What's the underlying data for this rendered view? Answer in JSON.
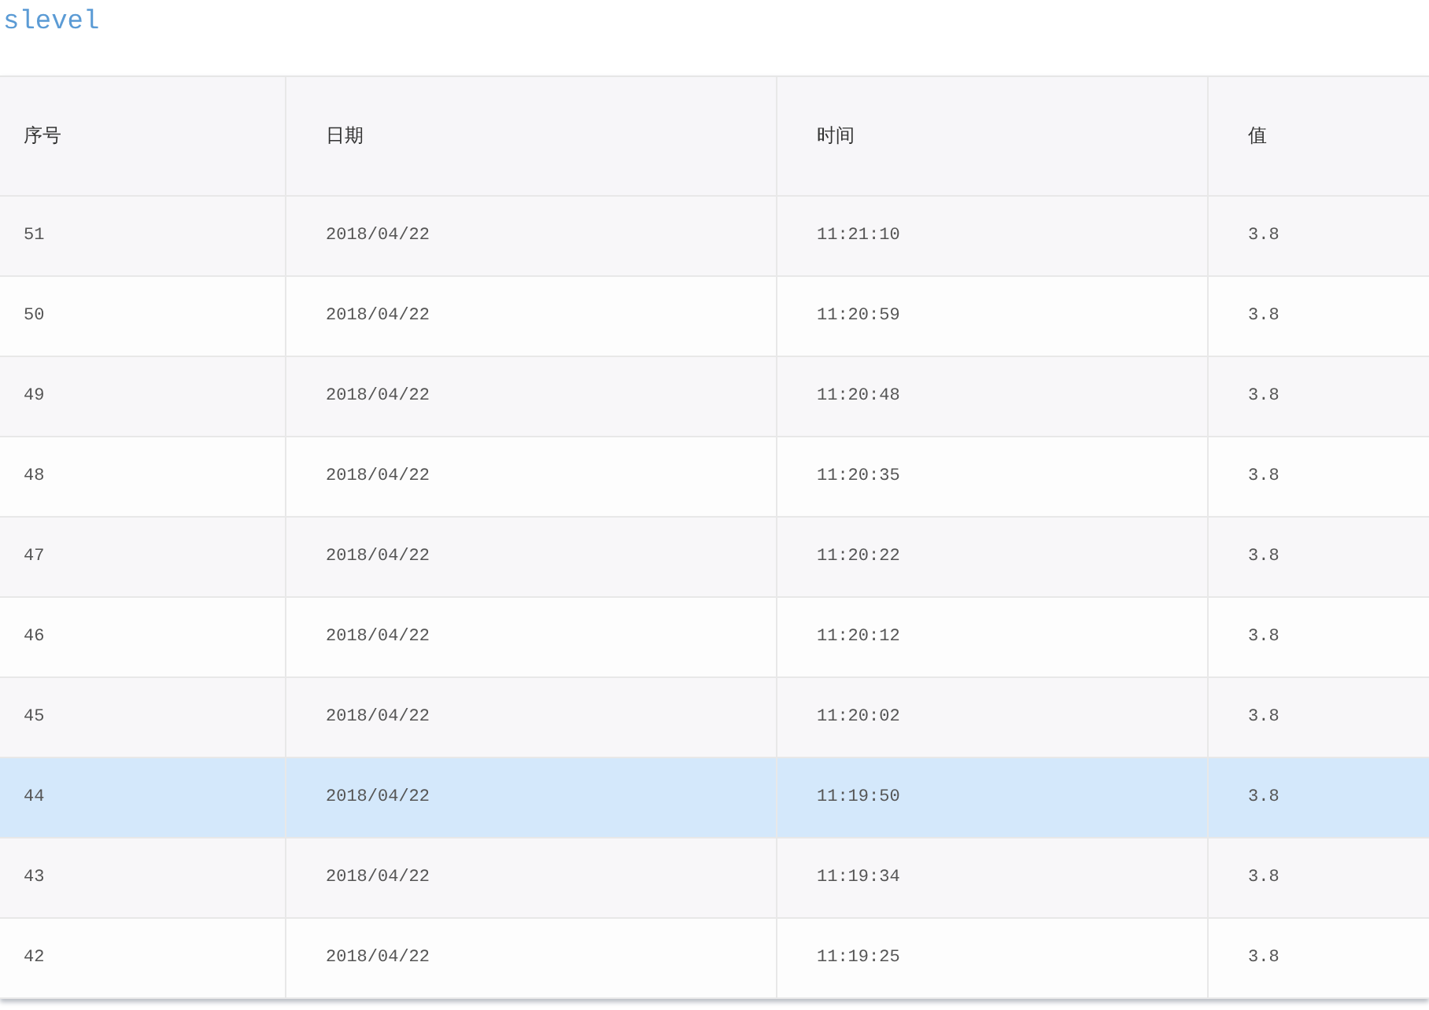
{
  "title": "slevel",
  "table": {
    "columns": [
      "序号",
      "日期",
      "时间",
      "值"
    ],
    "rows": [
      {
        "cells": [
          "51",
          "2018/04/22",
          "11:21:10",
          "3.8"
        ],
        "selected": false
      },
      {
        "cells": [
          "50",
          "2018/04/22",
          "11:20:59",
          "3.8"
        ],
        "selected": false
      },
      {
        "cells": [
          "49",
          "2018/04/22",
          "11:20:48",
          "3.8"
        ],
        "selected": false
      },
      {
        "cells": [
          "48",
          "2018/04/22",
          "11:20:35",
          "3.8"
        ],
        "selected": false
      },
      {
        "cells": [
          "47",
          "2018/04/22",
          "11:20:22",
          "3.8"
        ],
        "selected": false
      },
      {
        "cells": [
          "46",
          "2018/04/22",
          "11:20:12",
          "3.8"
        ],
        "selected": false
      },
      {
        "cells": [
          "45",
          "2018/04/22",
          "11:20:02",
          "3.8"
        ],
        "selected": false
      },
      {
        "cells": [
          "44",
          "2018/04/22",
          "11:19:50",
          "3.8"
        ],
        "selected": true
      },
      {
        "cells": [
          "43",
          "2018/04/22",
          "11:19:34",
          "3.8"
        ],
        "selected": false
      },
      {
        "cells": [
          "42",
          "2018/04/22",
          "11:19:25",
          "3.8"
        ],
        "selected": false
      }
    ]
  }
}
